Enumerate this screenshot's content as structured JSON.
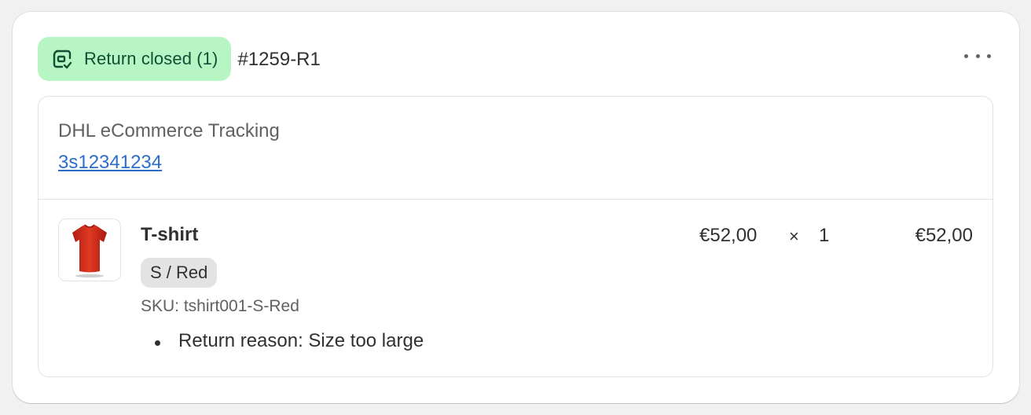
{
  "return": {
    "status_label": "Return closed (1)",
    "id": "#1259-R1",
    "colors": {
      "badge_bg": "#b7f5c4",
      "badge_text": "#0c5132",
      "link": "#2c6ecb"
    }
  },
  "tracking": {
    "carrier": "DHL eCommerce Tracking",
    "number": "3s12341234"
  },
  "line_item": {
    "title": "T-shirt",
    "variant": "S / Red",
    "sku": "SKU: tshirt001-S-Red",
    "unit_price": "€52,00",
    "times": "×",
    "quantity": "1",
    "total": "€52,00",
    "reasons": [
      "Return reason: Size too large"
    ],
    "image": "red-tshirt-image"
  },
  "icons": {
    "status": "return-box-check-icon",
    "menu": "more-horizontal-icon"
  }
}
